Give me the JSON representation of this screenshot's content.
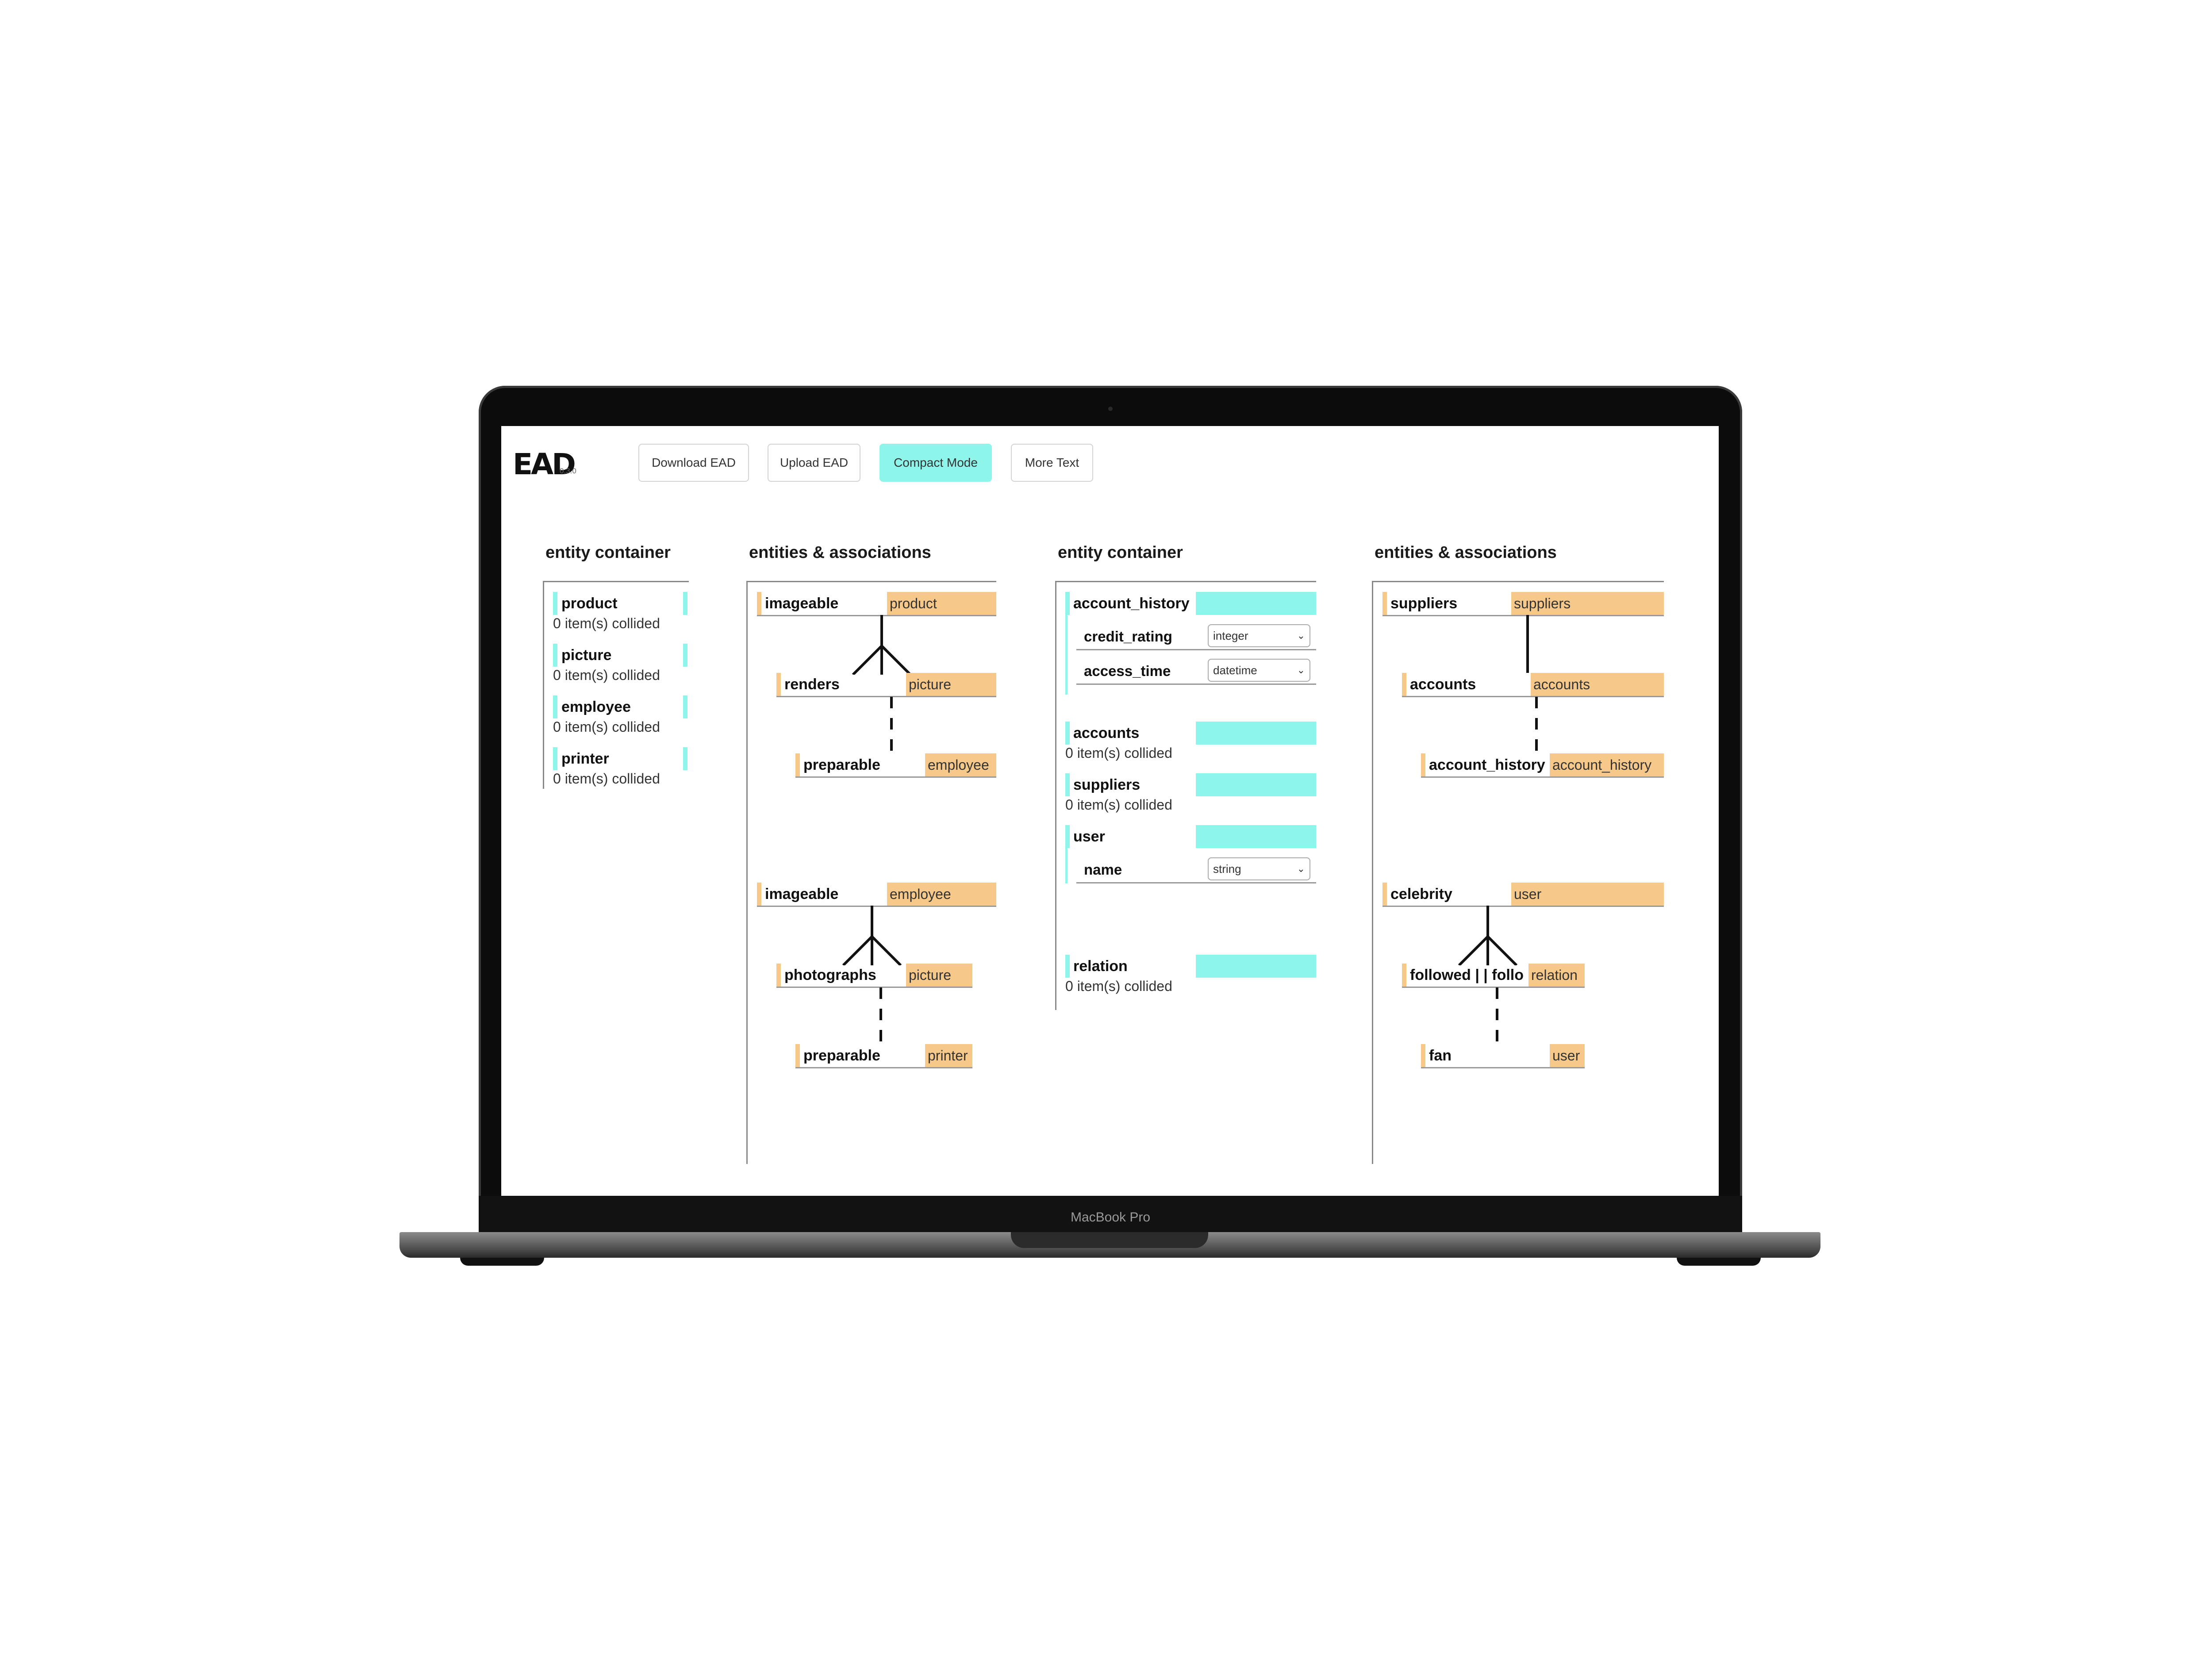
{
  "device": {
    "brand_label": "MacBook Pro"
  },
  "app": {
    "logo": {
      "text": "EAD",
      "version": "0.3.0"
    },
    "toolbar": [
      {
        "label": "Download EAD",
        "active": false
      },
      {
        "label": "Upload EAD",
        "active": false
      },
      {
        "label": "Compact Mode",
        "active": true
      },
      {
        "label": "More Text",
        "active": false
      }
    ],
    "colors": {
      "entity_accent": "#8ef5ea",
      "association_accent": "#f6c88a"
    }
  },
  "column1": {
    "title": "entity container",
    "entities": [
      {
        "name": "product",
        "status": "0 item(s) collided"
      },
      {
        "name": "picture",
        "status": "0 item(s) collided"
      },
      {
        "name": "employee",
        "status": "0 item(s) collided"
      },
      {
        "name": "printer",
        "status": "0 item(s) collided"
      }
    ]
  },
  "column2": {
    "title": "entities & associations",
    "group1": {
      "root": {
        "name": "imageable",
        "tag": "product"
      },
      "child": {
        "name": "renders",
        "tag": "picture"
      },
      "leaf": {
        "name": "preparable",
        "tag": "employee"
      }
    },
    "group2": {
      "root": {
        "name": "imageable",
        "tag": "employee"
      },
      "child": {
        "name": "photographs",
        "tag": "picture"
      },
      "leaf": {
        "name": "preparable",
        "tag": "printer"
      }
    }
  },
  "column3": {
    "title": "entity container",
    "account_history": {
      "name": "account_history",
      "attributes": [
        {
          "name": "credit_rating",
          "type": "integer"
        },
        {
          "name": "access_time",
          "type": "datetime"
        }
      ]
    },
    "accounts": {
      "name": "accounts",
      "status": "0 item(s) collided"
    },
    "suppliers": {
      "name": "suppliers",
      "status": "0 item(s) collided"
    },
    "user": {
      "name": "user",
      "attributes": [
        {
          "name": "name",
          "type": "string"
        }
      ]
    },
    "relation": {
      "name": "relation",
      "status": "0 item(s) collided"
    }
  },
  "column4": {
    "title": "entities & associations",
    "group1": {
      "root": {
        "name": "suppliers",
        "tag": "suppliers"
      },
      "child": {
        "name": "accounts",
        "tag": "accounts"
      },
      "leaf": {
        "name": "account_history",
        "tag": "account_history"
      }
    },
    "group2": {
      "root": {
        "name": "celebrity",
        "tag": "user"
      },
      "child": {
        "name": "followed | | follo",
        "tag": "relation"
      },
      "leaf": {
        "name": "fan",
        "tag": "user"
      }
    }
  }
}
